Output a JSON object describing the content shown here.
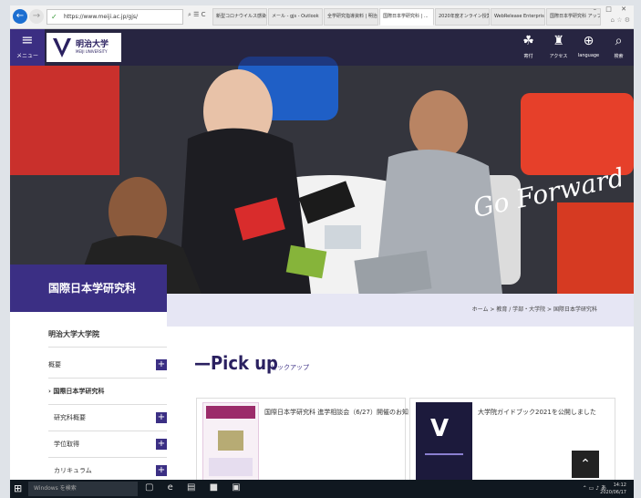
{
  "browser": {
    "url": "https://www.meiji.ac.jp/gjs/",
    "address_tools": "⌕ ☰ C",
    "tabs": [
      {
        "label": "新型コロナウイルス感染症...",
        "active": false
      },
      {
        "label": "メール - gjs - Outlook",
        "active": false
      },
      {
        "label": "全学研究指導資料 | 明治...",
        "active": false
      },
      {
        "label": "国際日本学研究科 | ...",
        "active": true
      },
      {
        "label": "2020年度オンライン授業...",
        "active": false
      },
      {
        "label": "WebRelease Enterprise...",
        "active": false
      },
      {
        "label": "国際日本学研究科 アップ...",
        "active": false
      }
    ],
    "window_controls": "– □ ✕"
  },
  "header": {
    "menu_label": "メニュー",
    "menu_glyph": "≡",
    "logo_jp": "明治大学",
    "logo_en": "MEIJI UNIVERSITY",
    "nav": [
      {
        "label": "寄付",
        "glyph": "☘"
      },
      {
        "label": "アクセス",
        "glyph": "♜"
      },
      {
        "label": "language",
        "glyph": "⊕"
      },
      {
        "label": "検索",
        "glyph": "⌕"
      }
    ]
  },
  "hero": {
    "slogan": "Go Forward"
  },
  "page": {
    "section_title": "国際日本学研究科",
    "breadcrumb": "ホーム > 教育 / 学部・大学院 > 国際日本学研究科"
  },
  "sidebar": {
    "heading": "明治大学大学院",
    "items": [
      {
        "label": "概要",
        "expandable": true
      },
      {
        "label": "国際日本学研究科",
        "expandable": false,
        "current": true
      },
      {
        "label": "研究科概要",
        "expandable": true
      },
      {
        "label": "学位取得",
        "expandable": true
      },
      {
        "label": "カリキュラム",
        "expandable": true
      }
    ]
  },
  "pickup": {
    "title": "—Pick up",
    "subtitle": "ピックアップ",
    "cards": [
      {
        "text": "国際日本学研究科 進学相談会（6/27）開催のお知らせ"
      },
      {
        "text": "大学院ガイドブック2021を公開しました"
      }
    ]
  },
  "to_top_glyph": "⌃",
  "taskbar": {
    "search_placeholder": "Windows を検索",
    "apps": "▢ e ▤ ■ ▣",
    "tray": "⌃ ▭ ♪ あ",
    "time": "14:12",
    "date": "2020/06/17"
  },
  "colors": {
    "brand": "#3b2f84",
    "taskbar": "#101820"
  }
}
